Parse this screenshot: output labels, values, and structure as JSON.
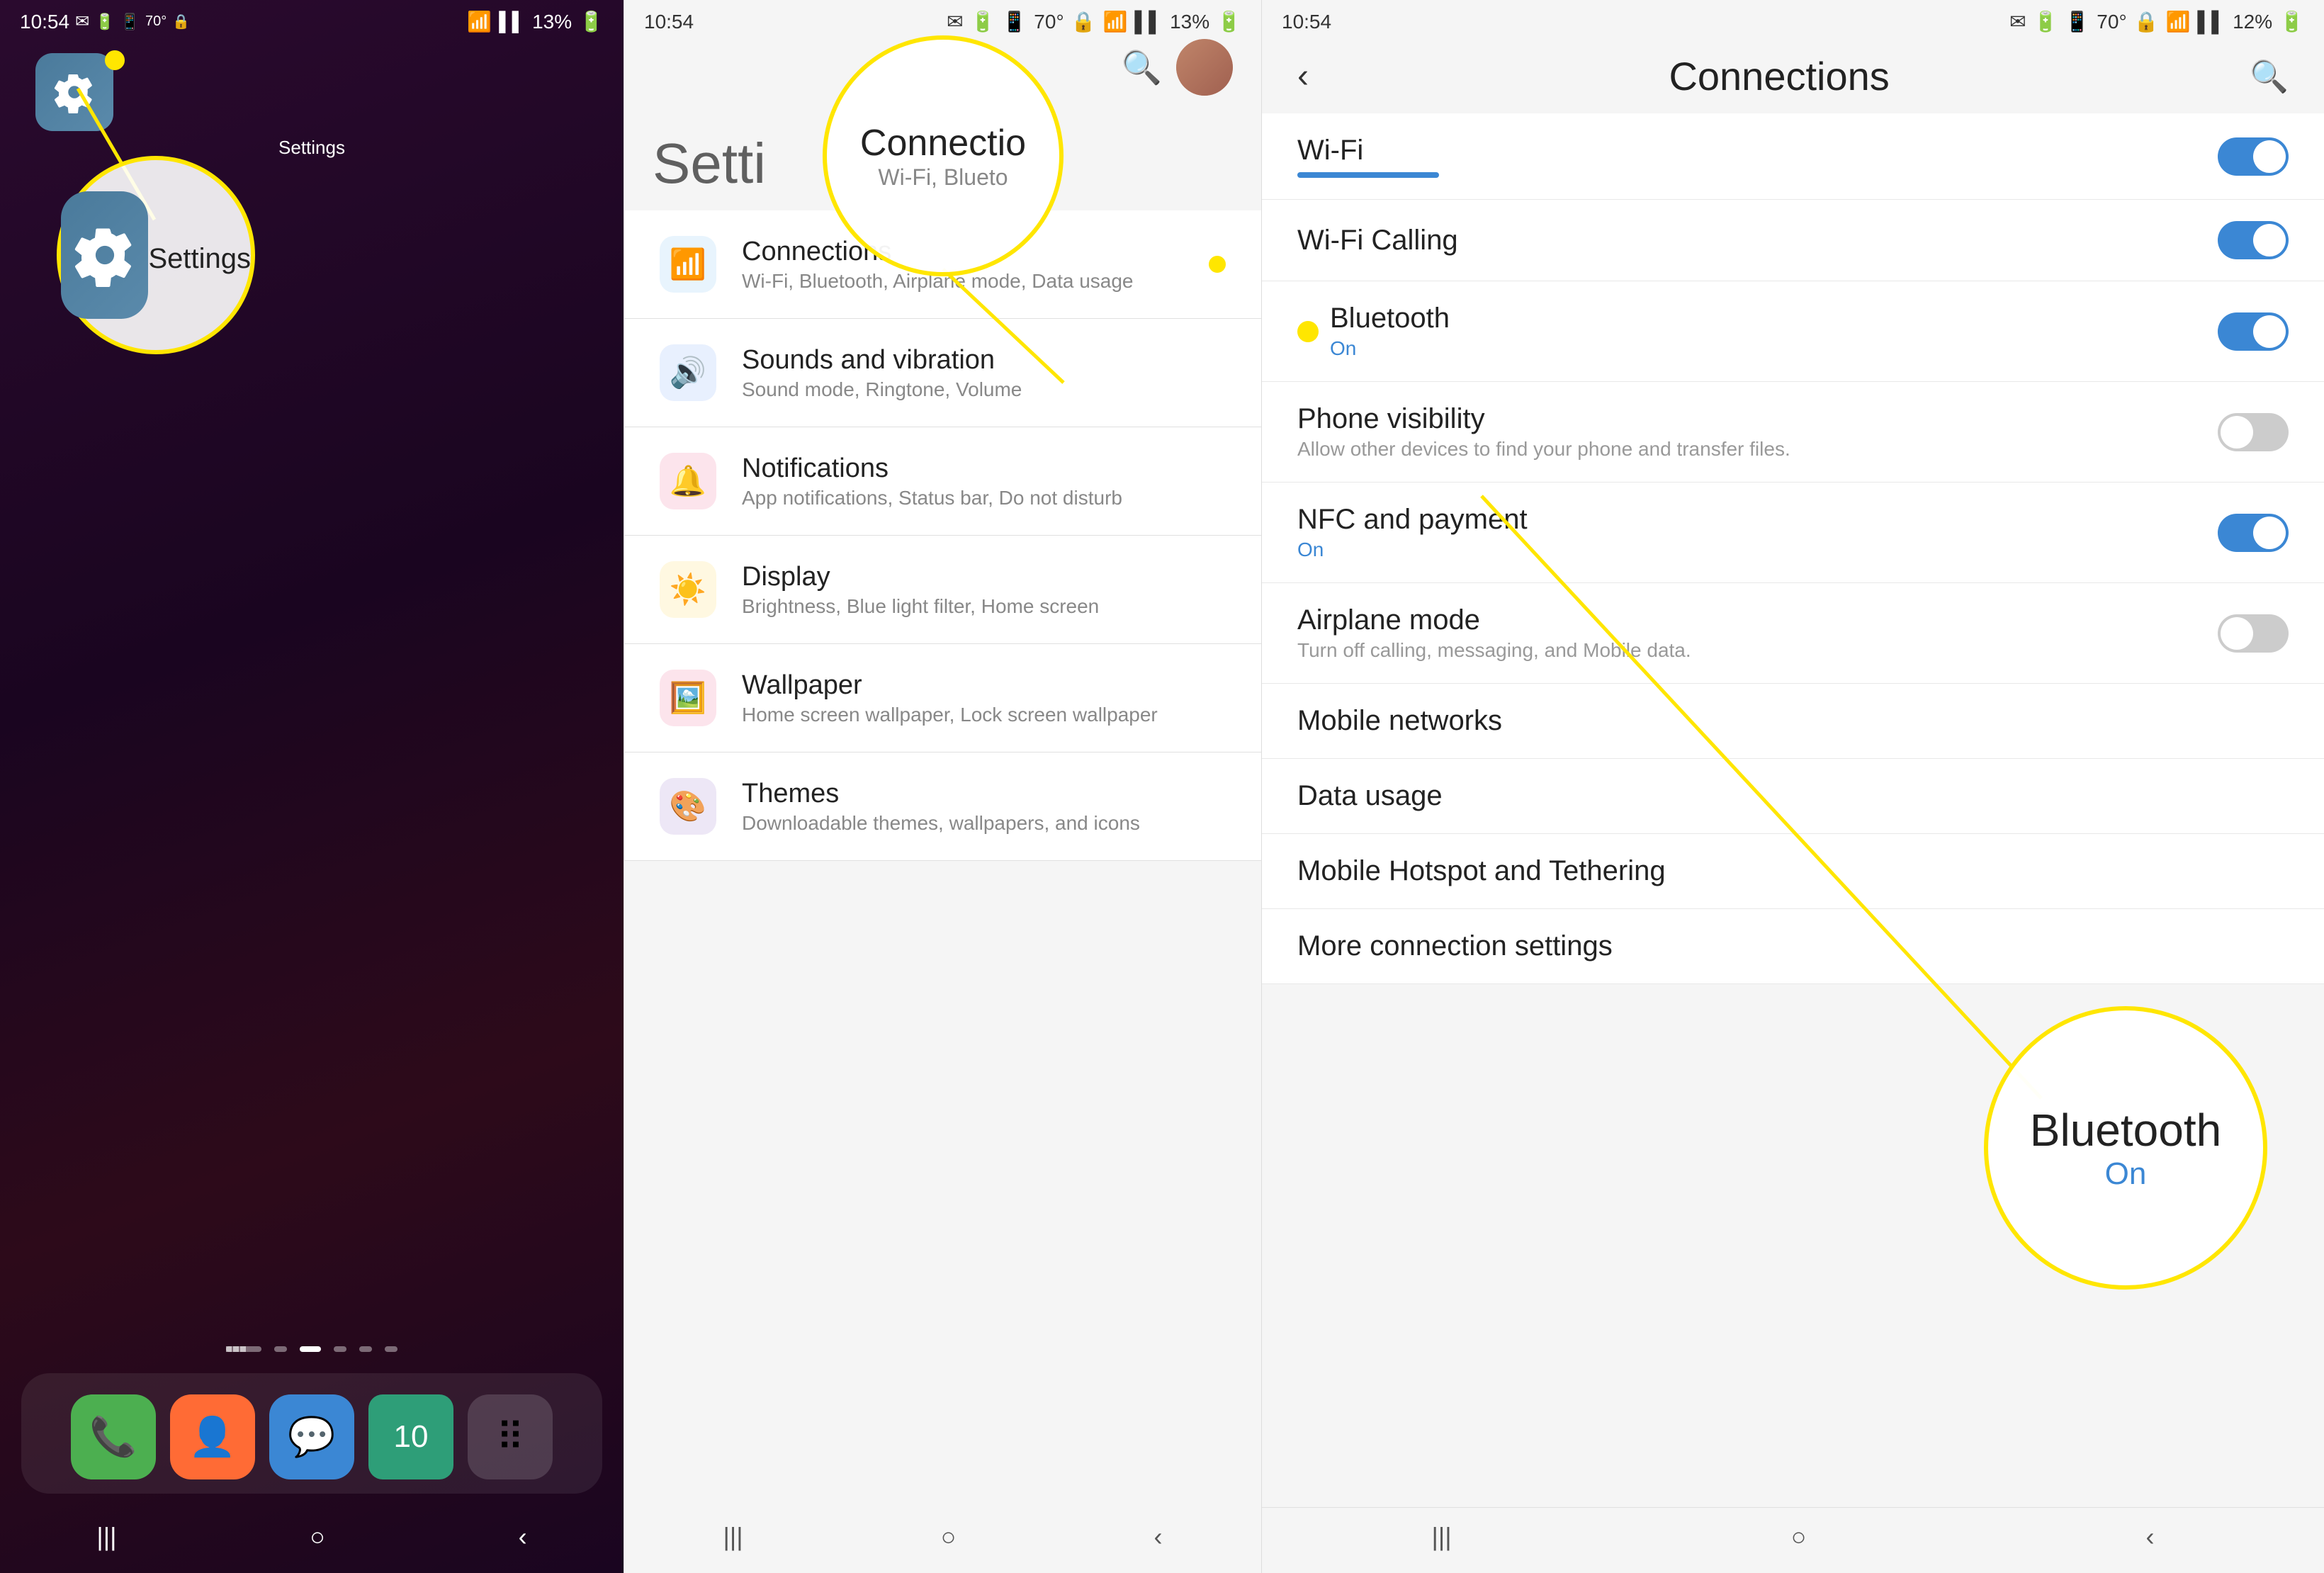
{
  "panel1": {
    "status_time": "10:54",
    "battery": "13%",
    "app_label_small": "Settings",
    "app_label_large": "Settings",
    "annotation_label": "Settings",
    "dots": [
      "lines",
      "dot",
      "dot",
      "dot",
      "dot",
      "dot"
    ],
    "dock": [
      {
        "label": "Phone",
        "icon": "📞"
      },
      {
        "label": "Contacts",
        "icon": "👤"
      },
      {
        "label": "Messages",
        "icon": "💬"
      },
      {
        "label": "Calendar",
        "icon": "📅"
      },
      {
        "label": "Apps",
        "icon": "⠿"
      }
    ],
    "nav": [
      "|||",
      "○",
      "<"
    ]
  },
  "panel2": {
    "status_time": "10:54",
    "battery": "13%",
    "title": "Setti",
    "popup_title": "Connectio",
    "popup_sub": "Wi-Fi, Blueto",
    "items": [
      {
        "icon": "wifi",
        "title": "Connections",
        "subtitle": "Wi-Fi, Bluetooth, Airplane mode, Data usage"
      },
      {
        "icon": "sound",
        "title": "Sounds and vibration",
        "subtitle": "Sound mode, Ringtone, Volume"
      },
      {
        "icon": "notif",
        "title": "Notifications",
        "subtitle": "App notifications, Status bar, Do not disturb"
      },
      {
        "icon": "display",
        "title": "Display",
        "subtitle": "Brightness, Blue light filter, Home screen"
      },
      {
        "icon": "wallpaper",
        "title": "Wallpaper",
        "subtitle": "Home screen wallpaper, Lock screen wallpaper"
      },
      {
        "icon": "themes",
        "title": "Themes",
        "subtitle": "Downloadable themes, wallpapers, and icons"
      }
    ]
  },
  "panel3": {
    "status_time": "10:54",
    "battery": "12%",
    "back_icon": "‹",
    "title": "Connections",
    "search_icon": "⌕",
    "items": [
      {
        "id": "wifi",
        "title": "Wi-Fi",
        "subtitle": "",
        "subtitle_bar": true,
        "toggle": "on"
      },
      {
        "id": "wifi-calling",
        "title": "Wi-Fi Calling",
        "subtitle": "",
        "toggle": "on"
      },
      {
        "id": "bluetooth",
        "title": "Bluetooth",
        "subtitle": "On",
        "subtitle_color": "blue",
        "toggle": "on",
        "has_dot": true
      },
      {
        "id": "phone-visibility",
        "title": "Phone visibility",
        "subtitle": "Allow other devices to find your phone and transfer files.",
        "subtitle_color": "gray",
        "toggle": "off"
      },
      {
        "id": "nfc",
        "title": "NFC and payment",
        "subtitle": "On",
        "subtitle_color": "blue",
        "toggle": "on"
      },
      {
        "id": "airplane",
        "title": "Airplane mode",
        "subtitle": "Turn off calling, messaging, and Mobile data.",
        "subtitle_color": "gray",
        "toggle": "off"
      },
      {
        "id": "mobile-networks",
        "title": "Mobile networks",
        "subtitle": "",
        "toggle": null
      },
      {
        "id": "data-usage",
        "title": "Data usage",
        "subtitle": "",
        "toggle": null
      },
      {
        "id": "mobile-hotspot",
        "title": "Mobile Hotspot and Tethering",
        "subtitle": "",
        "toggle": null
      },
      {
        "id": "more-connection",
        "title": "More connection settings",
        "subtitle": "",
        "toggle": null
      }
    ],
    "bluetooth_popup": {
      "title": "Bluetooth",
      "on_label": "On"
    }
  }
}
